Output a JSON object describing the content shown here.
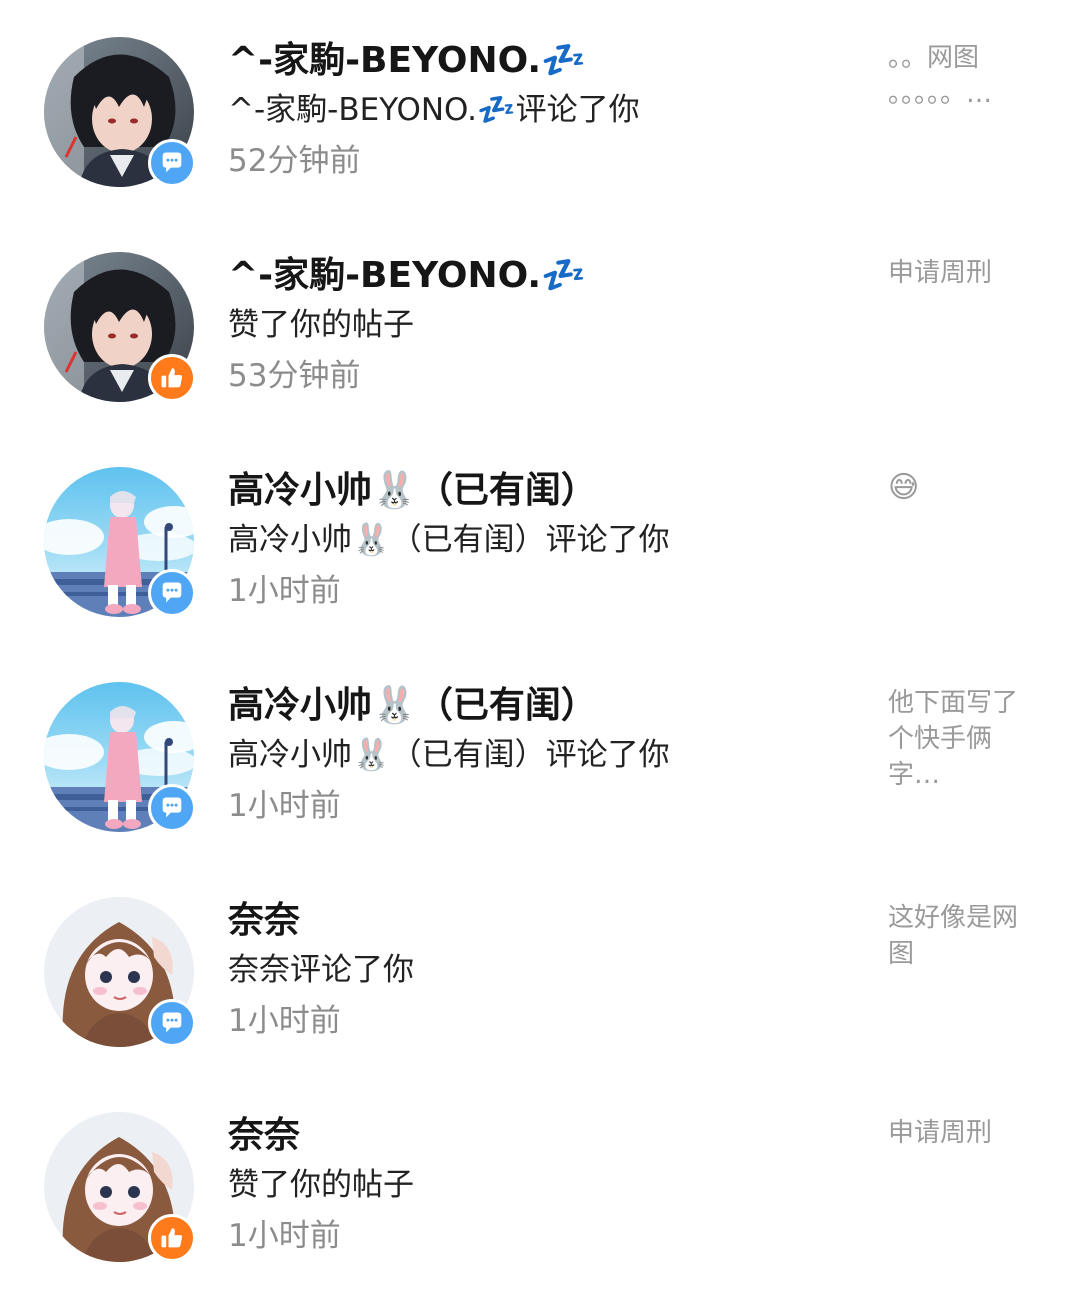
{
  "notifications": [
    {
      "name": "^-家駒-BEYONO.💤",
      "action": "^-家駒-BEYONO.💤评论了你",
      "time": "52分钟前",
      "preview": "。。网图 。。。。。…",
      "badge": "comment-icon",
      "avatar": "dark-haired-boy-avatar"
    },
    {
      "name": "^-家駒-BEYONO.💤",
      "action": "赞了你的帖子",
      "time": "53分钟前",
      "preview": "申请周刑",
      "badge": "thumbs-up-icon",
      "avatar": "dark-haired-boy-avatar"
    },
    {
      "name": "高冷小帅🐰（已有闺）",
      "action": "高冷小帅🐰（已有闺）评论了你",
      "time": "1小时前",
      "preview": "😅",
      "badge": "comment-icon",
      "avatar": "pink-girl-sky-avatar"
    },
    {
      "name": "高冷小帅🐰（已有闺）",
      "action": "高冷小帅🐰（已有闺）评论了你",
      "time": "1小时前",
      "preview": "他下面写了个快手俩字…",
      "badge": "comment-icon",
      "avatar": "pink-girl-sky-avatar"
    },
    {
      "name": "奈奈",
      "action": "奈奈评论了你",
      "time": "1小时前",
      "preview": "这好像是网图",
      "badge": "comment-icon",
      "avatar": "brown-haired-girl-avatar"
    },
    {
      "name": "奈奈",
      "action": "赞了你的帖子",
      "time": "1小时前",
      "preview": "申请周刑",
      "badge": "thumbs-up-icon",
      "avatar": "brown-haired-girl-avatar"
    }
  ],
  "colors": {
    "comment_badge": "#4ea6f5",
    "like_badge": "#ff7a1a",
    "time_text": "#8c8c8c",
    "preview_text": "#9a9a9a"
  }
}
